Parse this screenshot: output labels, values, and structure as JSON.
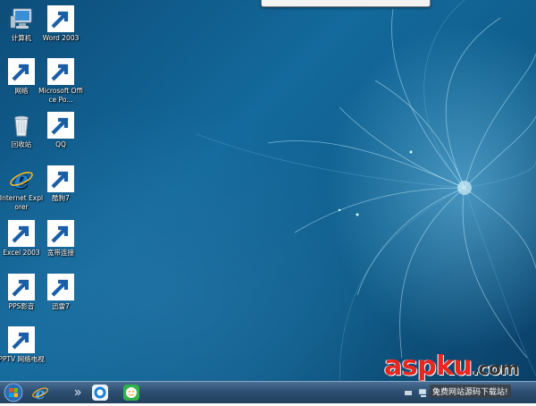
{
  "desktop": {
    "icons": [
      {
        "id": "computer",
        "label": "计算机",
        "icon": "computer-icon"
      },
      {
        "id": "word",
        "label": "Word 2003",
        "icon": "word-icon"
      },
      {
        "id": "network",
        "label": "网络",
        "icon": "network-icon"
      },
      {
        "id": "powerpoint",
        "label": "Microsoft Office Po...",
        "icon": "powerpoint-icon"
      },
      {
        "id": "recycle",
        "label": "回收站",
        "icon": "recycle-bin-icon"
      },
      {
        "id": "qq",
        "label": "QQ",
        "icon": "qq-penguin-icon"
      },
      {
        "id": "ie",
        "label": "Internet Explorer",
        "icon": "internet-explorer-icon"
      },
      {
        "id": "kugou",
        "label": "酷狗7",
        "icon": "kugou-icon"
      },
      {
        "id": "excel",
        "label": "Excel 2003",
        "icon": "excel-icon"
      },
      {
        "id": "broadband",
        "label": "宽带连接",
        "icon": "broadband-connection-icon"
      },
      {
        "id": "pps",
        "label": "PPS影音",
        "icon": "pps-icon"
      },
      {
        "id": "xunlei",
        "label": "迅雷7",
        "icon": "xunlei-icon"
      },
      {
        "id": "pptv",
        "label": "PPTV 网络电视",
        "icon": "pptv-icon"
      }
    ]
  },
  "taskbar": {
    "pinned": [
      "internet-explorer-icon",
      "pptv-icon",
      "pps-icon"
    ],
    "tray": [
      "tray-icon-1",
      "network-tray-icon",
      "volume-icon"
    ]
  },
  "watermark": {
    "brand": "aspku",
    "suffix": ".com",
    "tagline": "免费网站源码下载站!"
  },
  "colors": {
    "wallpaper": "#136a9c",
    "taskbar": "#2d4f72",
    "brand_red": "#e8271f"
  }
}
